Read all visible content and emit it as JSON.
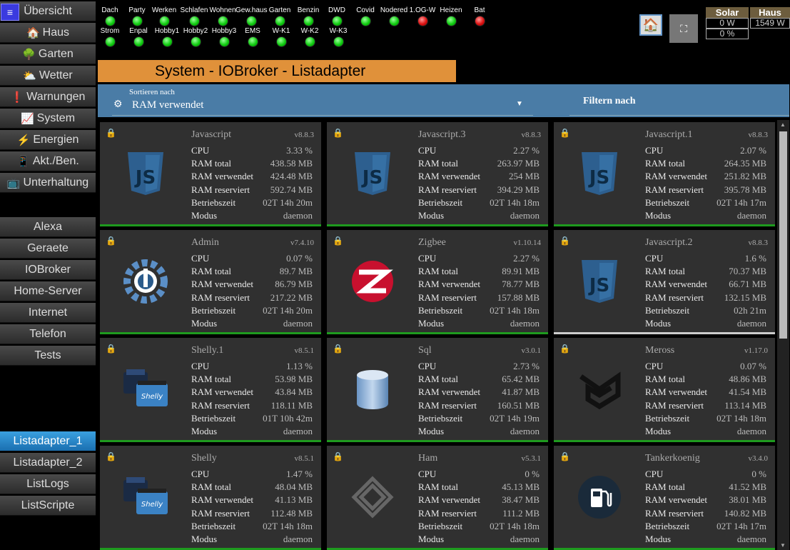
{
  "sidebar": {
    "menu_icon": "hamburger-icon",
    "items": [
      {
        "label": "Übersicht",
        "icon": ""
      },
      {
        "label": "Haus",
        "icon": "🏠"
      },
      {
        "label": "Garten",
        "icon": "🌳"
      },
      {
        "label": "Wetter",
        "icon": "⛅"
      },
      {
        "label": "Warnungen",
        "icon": "❗"
      },
      {
        "label": "System",
        "icon": "📈"
      },
      {
        "label": "Energien",
        "icon": "⚡"
      },
      {
        "label": "Akt./Ben.",
        "icon": "📱"
      },
      {
        "label": "Unterhaltung",
        "icon": "📺"
      }
    ],
    "group2": [
      "Alexa",
      "Geraete",
      "IOBroker",
      "Home-Server",
      "Internet",
      "Telefon",
      "Tests"
    ],
    "group3": [
      "Listadapter_1",
      "Listadapter_2",
      "ListLogs",
      "ListScripte"
    ],
    "active": "Listadapter_1"
  },
  "status": [
    {
      "label": "Dach",
      "state": "green"
    },
    {
      "label": "Party",
      "state": "green"
    },
    {
      "label": "Werken",
      "state": "green"
    },
    {
      "label": "Schlafen",
      "state": "green"
    },
    {
      "label": "Wohnen",
      "state": "green"
    },
    {
      "label": "Gew.haus",
      "state": "green"
    },
    {
      "label": "Garten",
      "state": "green"
    },
    {
      "label": "Benzin",
      "state": "green"
    },
    {
      "label": "DWD",
      "state": "green"
    },
    {
      "label": "Covid",
      "state": "green"
    },
    {
      "label": "Nodered",
      "state": "green"
    },
    {
      "label": "1.OG-W",
      "state": "red"
    },
    {
      "label": "Heizen",
      "state": "green"
    },
    {
      "label": "Bat",
      "state": "red"
    },
    {
      "label": "Strom",
      "state": "green"
    },
    {
      "label": "Enpal",
      "state": "green"
    },
    {
      "label": "Hobby1",
      "state": "green"
    },
    {
      "label": "Hobby2",
      "state": "green"
    },
    {
      "label": "Hobby3",
      "state": "green"
    },
    {
      "label": "EMS",
      "state": "green"
    },
    {
      "label": "W-K1",
      "state": "green"
    },
    {
      "label": "W-K2",
      "state": "green"
    },
    {
      "label": "W-K3",
      "state": "green"
    }
  ],
  "energy": {
    "solar_label": "Solar",
    "haus_label": "Haus",
    "solar_w": "0 W",
    "haus_w": "1549 W",
    "solar_pct": "0 %"
  },
  "title": "System - IOBroker - Listadapter",
  "filter": {
    "sort_label": "Sortieren nach",
    "sort_value": "RAM verwendet",
    "filter_label": "Filtern nach"
  },
  "row_labels": [
    "CPU",
    "RAM total",
    "RAM verwendet",
    "RAM reserviert",
    "Betriebszeit",
    "Modus"
  ],
  "cards": [
    {
      "name": "Javascript",
      "version": "v8.8.3",
      "logo": "js",
      "values": [
        "3.33 %",
        "438.58 MB",
        "424.48 MB",
        "592.74 MB",
        "02T 14h 20m",
        "daemon"
      ]
    },
    {
      "name": "Javascript.3",
      "version": "v8.8.3",
      "logo": "js",
      "values": [
        "2.27 %",
        "263.97 MB",
        "254 MB",
        "394.29 MB",
        "02T 14h 18m",
        "daemon"
      ]
    },
    {
      "name": "Javascript.1",
      "version": "v8.8.3",
      "logo": "js",
      "values": [
        "2.07 %",
        "264.35 MB",
        "251.82 MB",
        "395.78 MB",
        "02T 14h 17m",
        "daemon"
      ]
    },
    {
      "name": "Admin",
      "version": "v7.4.10",
      "logo": "admin",
      "values": [
        "0.07 %",
        "89.7 MB",
        "86.79 MB",
        "217.22 MB",
        "02T 14h 20m",
        "daemon"
      ]
    },
    {
      "name": "Zigbee",
      "version": "v1.10.14",
      "logo": "zigbee",
      "values": [
        "2.27 %",
        "89.91 MB",
        "78.77 MB",
        "157.88 MB",
        "02T 14h 18m",
        "daemon"
      ]
    },
    {
      "name": "Javascript.2",
      "version": "v8.8.3",
      "logo": "js",
      "values": [
        "1.6 %",
        "70.37 MB",
        "66.71 MB",
        "132.15 MB",
        "02h 21m",
        "daemon"
      ]
    },
    {
      "name": "Shelly.1",
      "version": "v8.5.1",
      "logo": "shelly",
      "values": [
        "1.13 %",
        "53.98 MB",
        "43.84 MB",
        "118.11 MB",
        "01T 10h 42m",
        "daemon"
      ]
    },
    {
      "name": "Sql",
      "version": "v3.0.1",
      "logo": "sql",
      "values": [
        "2.73 %",
        "65.42 MB",
        "41.87 MB",
        "160.51 MB",
        "02T 14h 19m",
        "daemon"
      ]
    },
    {
      "name": "Meross",
      "version": "v1.17.0",
      "logo": "meross",
      "values": [
        "0.07 %",
        "48.86 MB",
        "41.54 MB",
        "113.14 MB",
        "02T 14h 18m",
        "daemon"
      ]
    },
    {
      "name": "Shelly",
      "version": "v8.5.1",
      "logo": "shelly",
      "values": [
        "1.47 %",
        "48.04 MB",
        "41.13 MB",
        "112.48 MB",
        "02T 14h 18m",
        "daemon"
      ]
    },
    {
      "name": "Ham",
      "version": "v5.3.1",
      "logo": "ham",
      "values": [
        "0 %",
        "45.13 MB",
        "38.47 MB",
        "111.2 MB",
        "02T 14h 18m",
        "daemon"
      ]
    },
    {
      "name": "Tankerkoenig",
      "version": "v3.4.0",
      "logo": "tanker",
      "values": [
        "0 %",
        "41.52 MB",
        "38.01 MB",
        "140.82 MB",
        "02T 14h 17m",
        "daemon"
      ]
    }
  ]
}
